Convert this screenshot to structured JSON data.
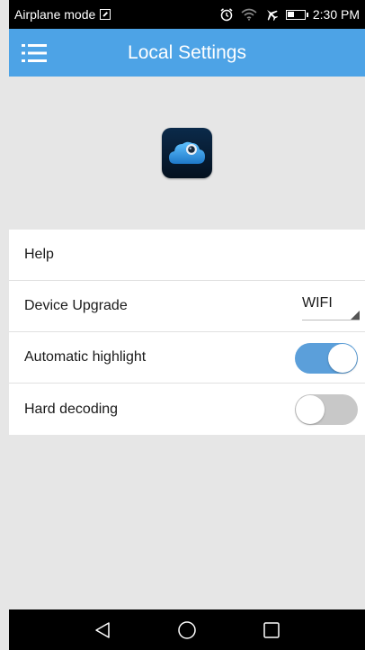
{
  "status_bar": {
    "mode_label": "Airplane mode",
    "time": "2:30 PM",
    "icons": [
      "sim-icon",
      "alarm-icon",
      "wifi-icon",
      "airplane-icon",
      "battery-icon"
    ]
  },
  "app_bar": {
    "title": "Local Settings",
    "menu_icon": "hamburger-menu-icon",
    "color": "#4da3e6"
  },
  "logo": {
    "icon": "cloud-camera-app-icon"
  },
  "settings": {
    "help_label": "Help",
    "device_upgrade_label": "Device Upgrade",
    "device_upgrade_value": "WIFI",
    "auto_highlight_label": "Automatic highlight",
    "auto_highlight_on": true,
    "hard_decoding_label": "Hard decoding",
    "hard_decoding_on": false,
    "toggle_on_color": "#5b9fda",
    "toggle_off_color": "#c8c8c8"
  },
  "nav_bar": {
    "icons": [
      "back-triangle-icon",
      "home-circle-icon",
      "recents-square-icon"
    ]
  }
}
